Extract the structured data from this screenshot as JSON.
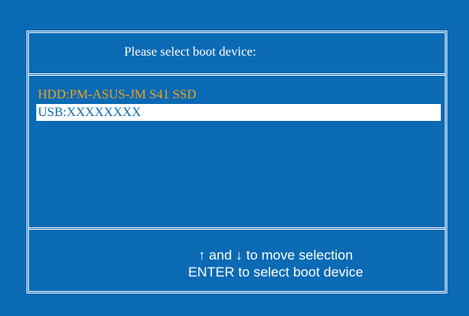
{
  "dialog": {
    "title": "Please select boot device:",
    "boot_devices": [
      {
        "label": "HDD:PM-ASUS-JM S41 SSD",
        "selected": false
      },
      {
        "label": "USB:XXXXXXXX",
        "selected": true
      }
    ],
    "help": {
      "line1": "↑ and ↓ to move selection",
      "line2": "ENTER to select boot device"
    }
  },
  "colors": {
    "background": "#0a6ab4",
    "border": "#ffffff",
    "unselected_text": "#f4a31c",
    "selected_highlight": "#ffffff",
    "selected_text": "#0a6ab4"
  }
}
